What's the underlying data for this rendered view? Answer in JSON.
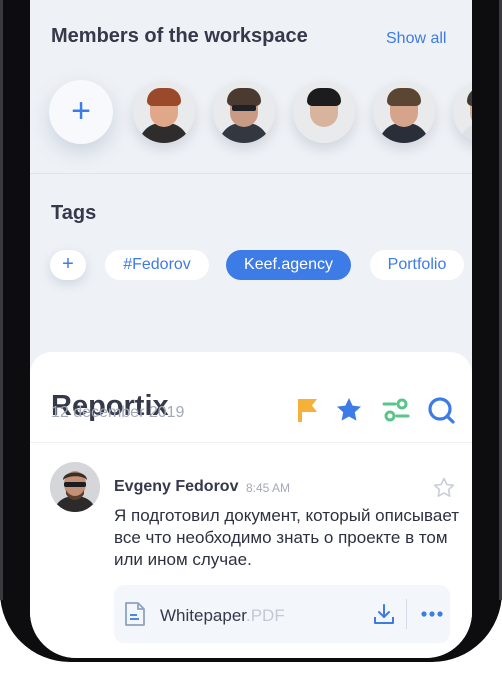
{
  "members": {
    "title": "Members of the workspace",
    "show_all_label": "Show all",
    "add_icon": "plus-icon",
    "avatars": [
      {
        "icon": "avatar-photo",
        "hair": "#9a4a2a",
        "face": "#e0a889",
        "body": "#2f2c2e"
      },
      {
        "icon": "avatar-photo",
        "hair": "#4a3a30",
        "face": "#c99b84",
        "body": "#333840"
      },
      {
        "icon": "avatar-photo",
        "hair": "#1c1c1f",
        "face": "#d8b39e",
        "body": "#e9eaec"
      },
      {
        "icon": "avatar-photo",
        "hair": "#5a4633",
        "face": "#d6a48a",
        "body": "#2a2e38"
      },
      {
        "icon": "avatar-photo",
        "hair": "#3f3a36",
        "face": "#d3ab98",
        "body": "#e0e1e4"
      }
    ]
  },
  "tags": {
    "title": "Tags",
    "add_icon": "plus-icon",
    "items": [
      {
        "label": "#Fedorov",
        "active": false
      },
      {
        "label": "Keef.agency",
        "active": true
      },
      {
        "label": "Portfolio",
        "active": false
      }
    ]
  },
  "card": {
    "title": "Reportix",
    "date": "12 december 2019",
    "icons": [
      "flag-icon",
      "star-icon",
      "filter-icon",
      "search-icon"
    ]
  },
  "message": {
    "author": "Evgeny Fedorov",
    "time": "8:45 AM",
    "text": "Я подготовил документ, который описывает  все что необходимо знать о проекте в том или ином случае.",
    "attachment": {
      "name": "Whitepaper",
      "extension": ".PDF",
      "file_icon": "document-icon",
      "download_icon": "download-icon",
      "more_icon": "more-icon"
    }
  },
  "colors": {
    "accent": "#3d7be6",
    "flag": "#f6b13a",
    "filter": "#5ac48a",
    "text": "#35394a",
    "muted": "#a3a9b8"
  }
}
